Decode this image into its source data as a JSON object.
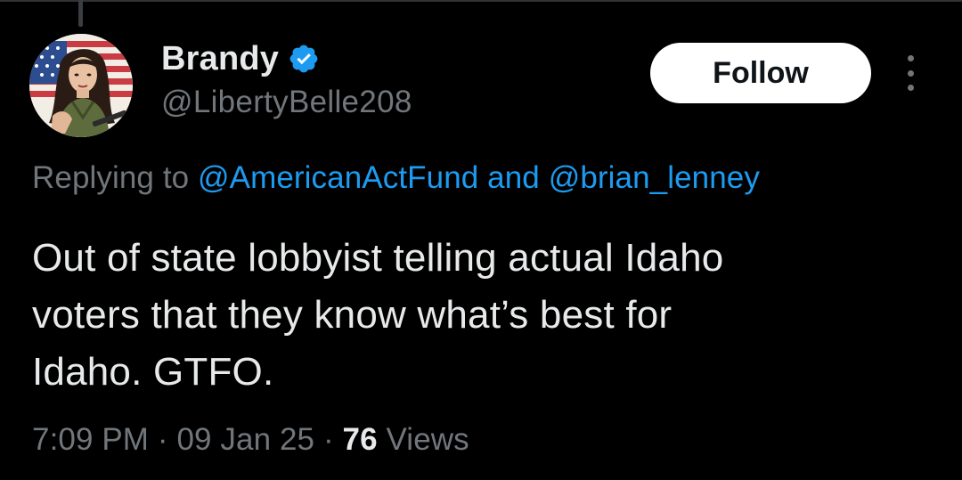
{
  "tweet": {
    "author": {
      "display_name": "Brandy",
      "handle": "@LibertyBelle208",
      "verified_icon": "verified-badge-icon",
      "avatar_icon": "avatar-illustration"
    },
    "follow_label": "Follow",
    "more_icon": "more-vertical-icon",
    "reply_prefix": "Replying to",
    "reply_mentions": [
      "@AmericanActFund",
      "@brian_lenney"
    ],
    "reply_conjunction": "and",
    "text_lines": [
      "Out of state lobbyist telling actual Idaho",
      "voters that they know what’s best for",
      "Idaho. GTFO."
    ],
    "time": "7:09 PM",
    "separator": "·",
    "date": "09 Jan 25",
    "views_count": "76",
    "views_label": "Views"
  },
  "colors": {
    "background": "#000000",
    "primary_text": "#e7e9ea",
    "secondary_text": "#71767b",
    "link": "#1d9bf0",
    "follow_bg": "#ffffff",
    "follow_text": "#0f1419"
  }
}
